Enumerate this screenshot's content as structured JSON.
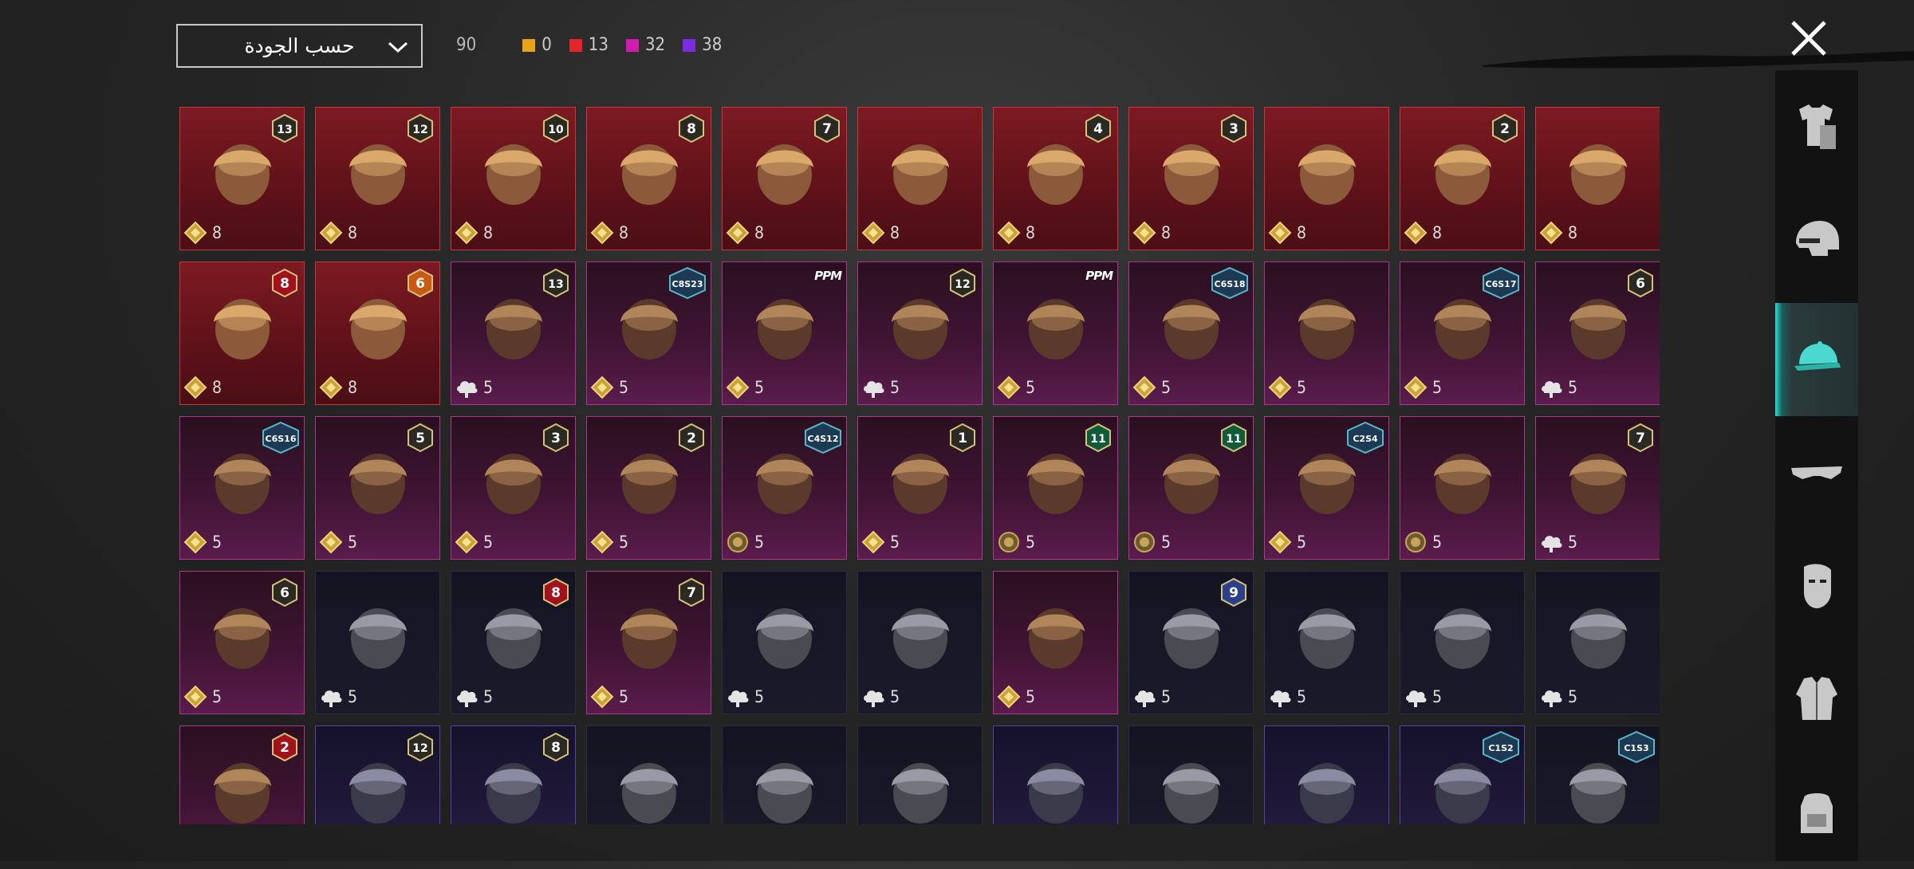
{
  "sort": {
    "label": "حسب الجودة"
  },
  "counts": {
    "total": "90",
    "items": [
      {
        "value": "0",
        "color": "#e8a317"
      },
      {
        "value": "13",
        "color": "#e5252c"
      },
      {
        "value": "32",
        "color": "#d21bb4"
      },
      {
        "value": "38",
        "color": "#7b2be0"
      }
    ]
  },
  "sidebar": {
    "tabs": [
      {
        "name": "tab-outfits",
        "icon": "outfit-icon",
        "active": false
      },
      {
        "name": "tab-helmets",
        "icon": "helmet-icon",
        "active": false
      },
      {
        "name": "tab-hats",
        "icon": "cap-icon",
        "active": true
      },
      {
        "name": "tab-eyewear",
        "icon": "glasses-icon",
        "active": false
      },
      {
        "name": "tab-masks",
        "icon": "mask-icon",
        "active": false
      },
      {
        "name": "tab-jackets",
        "icon": "jacket-icon",
        "active": false
      },
      {
        "name": "tab-backpacks",
        "icon": "backpack-icon",
        "active": false
      }
    ]
  },
  "items": [
    {
      "rarity": "red",
      "badge": {
        "type": "level",
        "text": "13",
        "style": "dark"
      },
      "cost": {
        "icon": "gold-diamond-icon",
        "value": "8"
      },
      "art": "feathered-hat-hair"
    },
    {
      "rarity": "red",
      "badge": {
        "type": "level",
        "text": "12",
        "style": "dark"
      },
      "cost": {
        "icon": "gold-diamond-icon",
        "value": "8"
      },
      "art": "white-hair"
    },
    {
      "rarity": "red",
      "badge": {
        "type": "level",
        "text": "10",
        "style": "dark"
      },
      "cost": {
        "icon": "gold-diamond-icon",
        "value": "8"
      },
      "art": "dark-long-hair"
    },
    {
      "rarity": "red",
      "badge": {
        "type": "level",
        "text": "8",
        "style": "dark"
      },
      "cost": {
        "icon": "gold-diamond-icon",
        "value": "8"
      },
      "art": "platinum-hair"
    },
    {
      "rarity": "red",
      "badge": {
        "type": "level",
        "text": "7",
        "style": "dark"
      },
      "cost": {
        "icon": "gold-diamond-icon",
        "value": "8"
      },
      "art": "white-ponytail"
    },
    {
      "rarity": "red",
      "badge": null,
      "cost": {
        "icon": "gold-diamond-icon",
        "value": "8"
      },
      "art": "red-helmet"
    },
    {
      "rarity": "red",
      "badge": {
        "type": "level",
        "text": "4",
        "style": "dark"
      },
      "cost": {
        "icon": "gold-diamond-icon",
        "value": "8"
      },
      "art": "snowman-top-hat"
    },
    {
      "rarity": "red",
      "badge": {
        "type": "level",
        "text": "3",
        "style": "dark"
      },
      "cost": {
        "icon": "gold-diamond-icon",
        "value": "8"
      },
      "art": "joker-mask"
    },
    {
      "rarity": "red",
      "badge": null,
      "cost": {
        "icon": "gold-diamond-icon",
        "value": "8"
      },
      "art": "green-dragon-helm"
    },
    {
      "rarity": "red",
      "badge": {
        "type": "level",
        "text": "2",
        "style": "dark"
      },
      "cost": {
        "icon": "gold-diamond-icon",
        "value": "8"
      },
      "art": "ice-bucket-hat"
    },
    {
      "rarity": "red",
      "badge": null,
      "cost": {
        "icon": "gold-diamond-icon",
        "value": "8"
      },
      "art": "red-horned-mask"
    },
    {
      "rarity": "red",
      "badge": {
        "type": "level",
        "text": "8",
        "style": "red"
      },
      "cost": {
        "icon": "gold-diamond-icon",
        "value": "8"
      },
      "art": "red-wizard-hat"
    },
    {
      "rarity": "red",
      "badge": {
        "type": "level",
        "text": "6",
        "style": "orange"
      },
      "cost": {
        "icon": "gold-diamond-icon",
        "value": "8"
      },
      "art": "ice-block-helm"
    },
    {
      "rarity": "purple",
      "badge": {
        "type": "level",
        "text": "13",
        "style": "dark"
      },
      "cost": {
        "icon": "cloud-icon",
        "value": "5"
      },
      "art": "aviator-goggles"
    },
    {
      "rarity": "purple",
      "badge": {
        "type": "season",
        "text": "C8S23"
      },
      "cost": {
        "icon": "gold-diamond-icon",
        "value": "5"
      },
      "art": "cat-headphones"
    },
    {
      "rarity": "purple",
      "badge": {
        "type": "ppm",
        "text": "PPM"
      },
      "cost": {
        "icon": "gold-diamond-icon",
        "value": "5"
      },
      "art": "cap-glasses"
    },
    {
      "rarity": "purple",
      "badge": {
        "type": "level",
        "text": "12",
        "style": "dark"
      },
      "cost": {
        "icon": "cloud-icon",
        "value": "5"
      },
      "art": "braided-hair"
    },
    {
      "rarity": "purple",
      "badge": {
        "type": "ppm",
        "text": "PPM"
      },
      "cost": {
        "icon": "gold-diamond-icon",
        "value": "5"
      },
      "art": "llama-mask"
    },
    {
      "rarity": "purple",
      "badge": {
        "type": "season",
        "text": "C6S18"
      },
      "cost": {
        "icon": "gold-diamond-icon",
        "value": "5"
      },
      "art": "brown-short-hair"
    },
    {
      "rarity": "purple",
      "badge": null,
      "cost": {
        "icon": "gold-diamond-icon",
        "value": "5"
      },
      "art": "purple-sci-helmet"
    },
    {
      "rarity": "purple",
      "badge": {
        "type": "season",
        "text": "C6S17"
      },
      "cost": {
        "icon": "gold-diamond-icon",
        "value": "5"
      },
      "art": "visor-spiky-hair"
    },
    {
      "rarity": "purple",
      "badge": {
        "type": "level",
        "text": "6",
        "style": "dark"
      },
      "cost": {
        "icon": "cloud-icon",
        "value": "5"
      },
      "art": "dark-ninja-helm"
    },
    {
      "rarity": "purple",
      "badge": {
        "type": "season",
        "text": "C6S16"
      },
      "cost": {
        "icon": "gold-diamond-icon",
        "value": "5"
      },
      "art": "red-hair"
    },
    {
      "rarity": "purple",
      "badge": {
        "type": "level",
        "text": "5",
        "style": "dark"
      },
      "cost": {
        "icon": "gold-diamond-icon",
        "value": "5"
      },
      "art": "pigtails"
    },
    {
      "rarity": "purple",
      "badge": {
        "type": "level",
        "text": "3",
        "style": "dark"
      },
      "cost": {
        "icon": "gold-diamond-icon",
        "value": "5"
      },
      "art": "jester-hat"
    },
    {
      "rarity": "purple",
      "badge": {
        "type": "level",
        "text": "2",
        "style": "dark"
      },
      "cost": {
        "icon": "gold-diamond-icon",
        "value": "5"
      },
      "art": "blonde-bandana"
    },
    {
      "rarity": "purple",
      "badge": {
        "type": "season",
        "text": "C4S12"
      },
      "cost": {
        "icon": "coin-icon",
        "value": "5"
      },
      "art": "ninja-headband"
    },
    {
      "rarity": "purple",
      "badge": {
        "type": "level",
        "text": "1",
        "style": "dark"
      },
      "cost": {
        "icon": "gold-diamond-icon",
        "value": "5"
      },
      "art": "silver-blue-hair"
    },
    {
      "rarity": "purple",
      "badge": {
        "type": "level",
        "text": "11",
        "style": "green"
      },
      "cost": {
        "icon": "coin-icon",
        "value": "5"
      },
      "art": "blue-beanie-feathers"
    },
    {
      "rarity": "purple",
      "badge": {
        "type": "level",
        "text": "11",
        "style": "green"
      },
      "cost": {
        "icon": "coin-icon",
        "value": "5"
      },
      "art": "asian-hat"
    },
    {
      "rarity": "purple",
      "badge": {
        "type": "season",
        "text": "C2S4"
      },
      "cost": {
        "icon": "gold-diamond-icon",
        "value": "5"
      },
      "art": "white-turban"
    },
    {
      "rarity": "purple",
      "badge": null,
      "cost": {
        "icon": "coin-icon",
        "value": "5"
      },
      "art": "dark-top-hat"
    },
    {
      "rarity": "purple",
      "badge": {
        "type": "level",
        "text": "7",
        "style": "dark"
      },
      "cost": {
        "icon": "cloud-icon",
        "value": "5"
      },
      "art": "crowned-hood"
    },
    {
      "rarity": "purple",
      "badge": {
        "type": "level",
        "text": "6",
        "style": "dark"
      },
      "cost": {
        "icon": "gold-diamond-icon",
        "value": "5"
      },
      "art": "santa-hat"
    },
    {
      "rarity": "dark",
      "badge": null,
      "cost": {
        "icon": "cloud-icon",
        "value": "5"
      },
      "art": "green-hood"
    },
    {
      "rarity": "dark",
      "badge": {
        "type": "level",
        "text": "8",
        "style": "red"
      },
      "cost": {
        "icon": "cloud-icon",
        "value": "5"
      },
      "art": "steampunk-hat"
    },
    {
      "rarity": "purple",
      "badge": {
        "type": "level",
        "text": "7",
        "style": "dark"
      },
      "cost": {
        "icon": "gold-diamond-icon",
        "value": "5"
      },
      "art": "captain-cap"
    },
    {
      "rarity": "dark",
      "badge": null,
      "cost": {
        "icon": "cloud-icon",
        "value": "5"
      },
      "art": "camo-beanie"
    },
    {
      "rarity": "dark",
      "badge": null,
      "cost": {
        "icon": "cloud-icon",
        "value": "5"
      },
      "art": "gas-mask"
    },
    {
      "rarity": "purple",
      "badge": null,
      "cost": {
        "icon": "gold-diamond-icon",
        "value": "5"
      },
      "art": "black-beanie"
    },
    {
      "rarity": "dark",
      "badge": {
        "type": "level",
        "text": "9",
        "style": "blue"
      },
      "cost": {
        "icon": "cloud-icon",
        "value": "5"
      },
      "art": "grey-dreads"
    },
    {
      "rarity": "dark",
      "badge": null,
      "cost": {
        "icon": "cloud-icon",
        "value": "5"
      },
      "art": "blue-feather-helm"
    },
    {
      "rarity": "dark",
      "badge": null,
      "cost": {
        "icon": "cloud-icon",
        "value": "5"
      },
      "art": "headband-horns"
    },
    {
      "rarity": "dark",
      "badge": null,
      "cost": {
        "icon": "cloud-icon",
        "value": "5"
      },
      "art": "white-bucket-hat"
    },
    {
      "rarity": "purple",
      "badge": {
        "type": "level",
        "text": "2",
        "style": "red"
      },
      "cost": null,
      "art": "bunny-mask"
    },
    {
      "rarity": "violet",
      "badge": {
        "type": "level",
        "text": "12",
        "style": "dark"
      },
      "cost": null,
      "art": "bunny-ears-helm"
    },
    {
      "rarity": "violet",
      "badge": {
        "type": "level",
        "text": "8",
        "style": "dark"
      },
      "cost": null,
      "art": "green-skull-hood"
    },
    {
      "rarity": "dark",
      "badge": null,
      "cost": null,
      "art": "baseball-cap"
    },
    {
      "rarity": "dark",
      "badge": null,
      "cost": null,
      "art": "tactical-helmet"
    },
    {
      "rarity": "dark",
      "badge": null,
      "cost": null,
      "art": "military-helmet"
    },
    {
      "rarity": "violet",
      "badge": null,
      "cost": null,
      "art": "orange-goggles-hair"
    },
    {
      "rarity": "dark",
      "badge": null,
      "cost": null,
      "art": "dotted-cap"
    },
    {
      "rarity": "violet",
      "badge": null,
      "cost": null,
      "art": "bucket-hat-red-hair"
    },
    {
      "rarity": "violet",
      "badge": {
        "type": "season",
        "text": "C1S2"
      },
      "cost": null,
      "art": "striped-beanie"
    },
    {
      "rarity": "dark",
      "badge": {
        "type": "season",
        "text": "C1S3"
      },
      "cost": null,
      "art": "leather-aviator"
    }
  ]
}
